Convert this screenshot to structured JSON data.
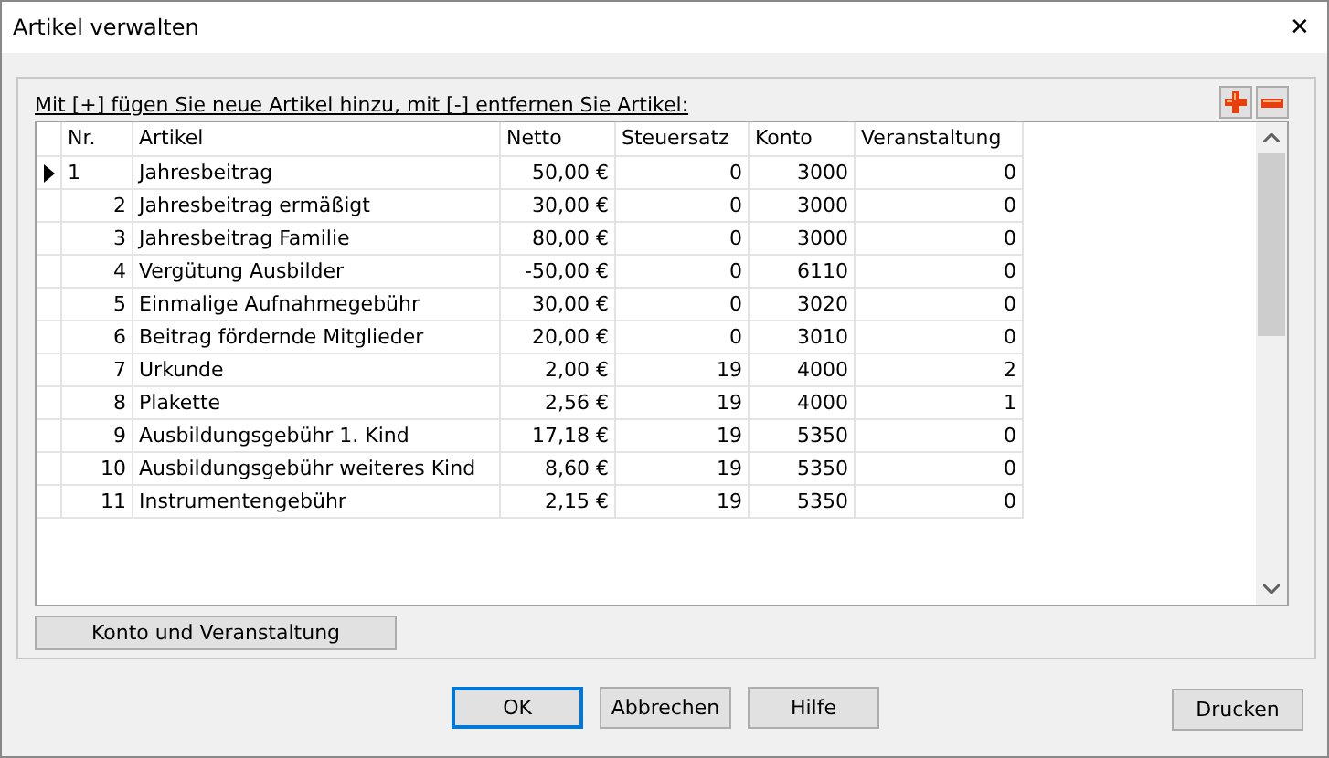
{
  "window": {
    "title": "Artikel verwalten",
    "close": "✕"
  },
  "hint": "Mit [+] fügen Sie neue Artikel hinzu, mit [-] entfernen Sie Artikel:",
  "table": {
    "columns": [
      "Nr.",
      "Artikel",
      "Netto",
      "Steuersatz",
      "Konto",
      "Veranstaltung"
    ],
    "rows": [
      {
        "selected": true,
        "cells": [
          "1",
          "Jahresbeitrag",
          "50,00 €",
          "0",
          "3000",
          "0"
        ]
      },
      {
        "selected": false,
        "cells": [
          "2",
          "Jahresbeitrag ermäßigt",
          "30,00 €",
          "0",
          "3000",
          "0"
        ]
      },
      {
        "selected": false,
        "cells": [
          "3",
          "Jahresbeitrag Familie",
          "80,00 €",
          "0",
          "3000",
          "0"
        ]
      },
      {
        "selected": false,
        "cells": [
          "4",
          "Vergütung Ausbilder",
          "-50,00 €",
          "0",
          "6110",
          "0"
        ]
      },
      {
        "selected": false,
        "cells": [
          "5",
          "Einmalige Aufnahmegebühr",
          "30,00 €",
          "0",
          "3020",
          "0"
        ]
      },
      {
        "selected": false,
        "cells": [
          "6",
          "Beitrag fördernde Mitglieder",
          "20,00 €",
          "0",
          "3010",
          "0"
        ]
      },
      {
        "selected": false,
        "cells": [
          "7",
          "Urkunde",
          "2,00 €",
          "19",
          "4000",
          "2"
        ]
      },
      {
        "selected": false,
        "cells": [
          "8",
          "Plakette",
          "2,56 €",
          "19",
          "4000",
          "1"
        ]
      },
      {
        "selected": false,
        "cells": [
          "9",
          "Ausbildungsgebühr 1. Kind",
          "17,18 €",
          "19",
          "5350",
          "0"
        ]
      },
      {
        "selected": false,
        "cells": [
          "10",
          "Ausbildungsgebühr weiteres Kind",
          "8,60 €",
          "19",
          "5350",
          "0"
        ]
      },
      {
        "selected": false,
        "cells": [
          "11",
          "Instrumentengebühr",
          "2,15 €",
          "19",
          "5350",
          "0"
        ]
      }
    ]
  },
  "group_button": "Konto und Veranstaltung",
  "buttons": [
    {
      "label": "OK",
      "kind": "default"
    },
    {
      "label": "Abbrechen",
      "kind": "normal"
    },
    {
      "label": "Hilfe",
      "kind": "normal"
    }
  ],
  "print_button": "Drucken"
}
